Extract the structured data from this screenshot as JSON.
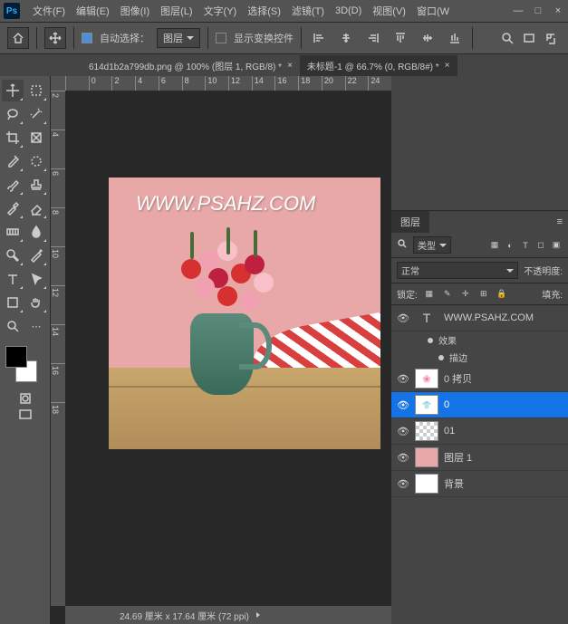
{
  "menubar": {
    "items": [
      "文件(F)",
      "编辑(E)",
      "图像(I)",
      "图层(L)",
      "文字(Y)",
      "选择(S)",
      "滤镜(T)",
      "3D(D)",
      "视图(V)",
      "窗口(W"
    ]
  },
  "optionsbar": {
    "auto_select": "自动选择：",
    "dropdown": "图层",
    "show_transform": "显示变换控件"
  },
  "tabs": [
    {
      "label": "614d1b2a799db.png @ 100% (图层 1, RGB/8) *"
    },
    {
      "label": "未标题-1 @ 66.7% (0, RGB/8#) *"
    }
  ],
  "rulers": {
    "h": [
      "",
      "0",
      "2",
      "4",
      "6",
      "8",
      "10",
      "12",
      "14",
      "16",
      "18",
      "20",
      "22",
      "24"
    ],
    "v": [
      "2",
      "4",
      "6",
      "8",
      "10",
      "12",
      "14",
      "16",
      "18"
    ]
  },
  "canvas": {
    "watermark": "WWW.PSAHZ.COM"
  },
  "statusbar": {
    "dims": "24.69 厘米 x 17.64 厘米 (72 ppi)"
  },
  "layers_panel": {
    "title": "图层",
    "filter_label": "类型",
    "blend_mode": "正常",
    "opacity_label": "不透明度:",
    "lock_label": "锁定:",
    "fill_label": "填充:",
    "layers": [
      {
        "name": "WWW.PSAHZ.COM",
        "type": "text"
      },
      {
        "fx": "效果"
      },
      {
        "fx_detail": "描边"
      },
      {
        "name": "0 拷贝",
        "type": "img"
      },
      {
        "name": "0",
        "type": "img",
        "selected": true
      },
      {
        "name": "01",
        "type": "checker"
      },
      {
        "name": "图层 1",
        "type": "pink"
      },
      {
        "name": "背景",
        "type": "white"
      }
    ]
  }
}
